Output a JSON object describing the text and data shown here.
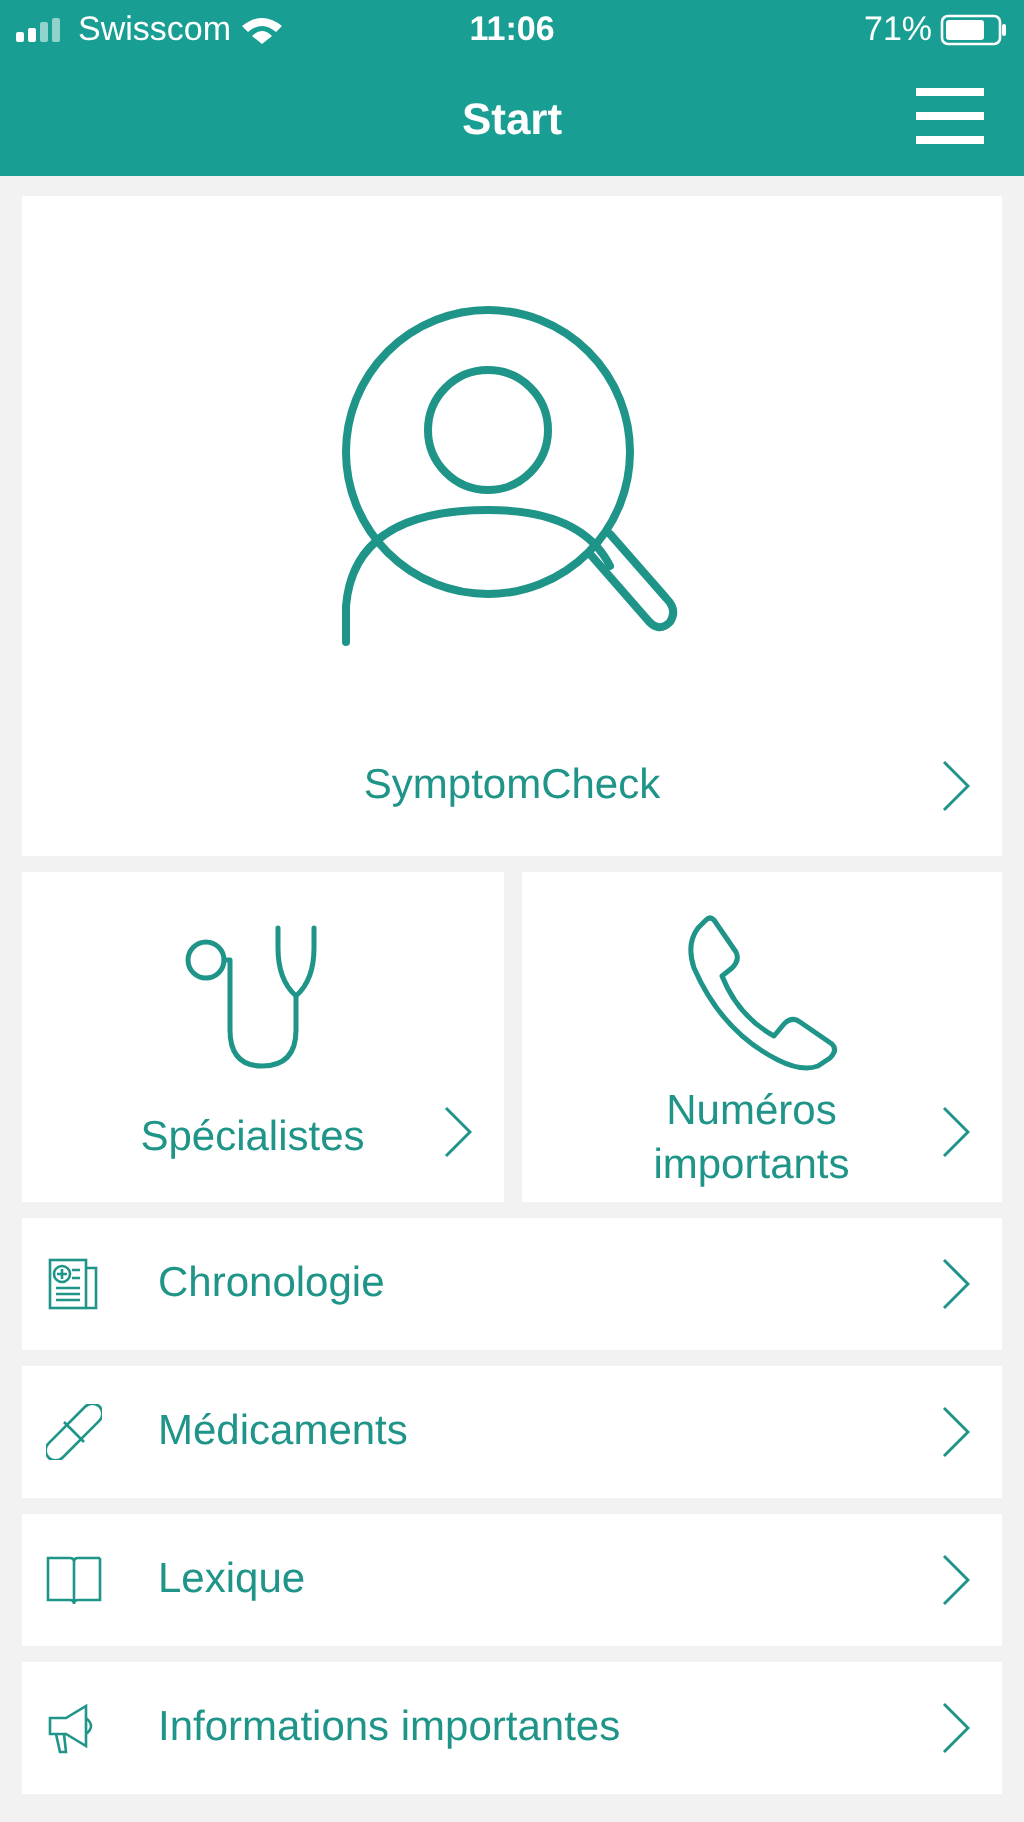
{
  "status_bar": {
    "carrier": "Swisscom",
    "time": "11:06",
    "battery": "71%"
  },
  "header": {
    "title": "Start"
  },
  "hero": {
    "label": "SymptomCheck"
  },
  "tiles": [
    {
      "kind": "stethoscope",
      "label": "Spécialistes"
    },
    {
      "kind": "phone",
      "label": "Numéros importants"
    }
  ],
  "menu": [
    {
      "kind": "news",
      "label": "Chronologie"
    },
    {
      "kind": "pill",
      "label": "Médicaments"
    },
    {
      "kind": "book",
      "label": "Lexique"
    },
    {
      "kind": "megaphone",
      "label": "Informations importantes"
    }
  ]
}
